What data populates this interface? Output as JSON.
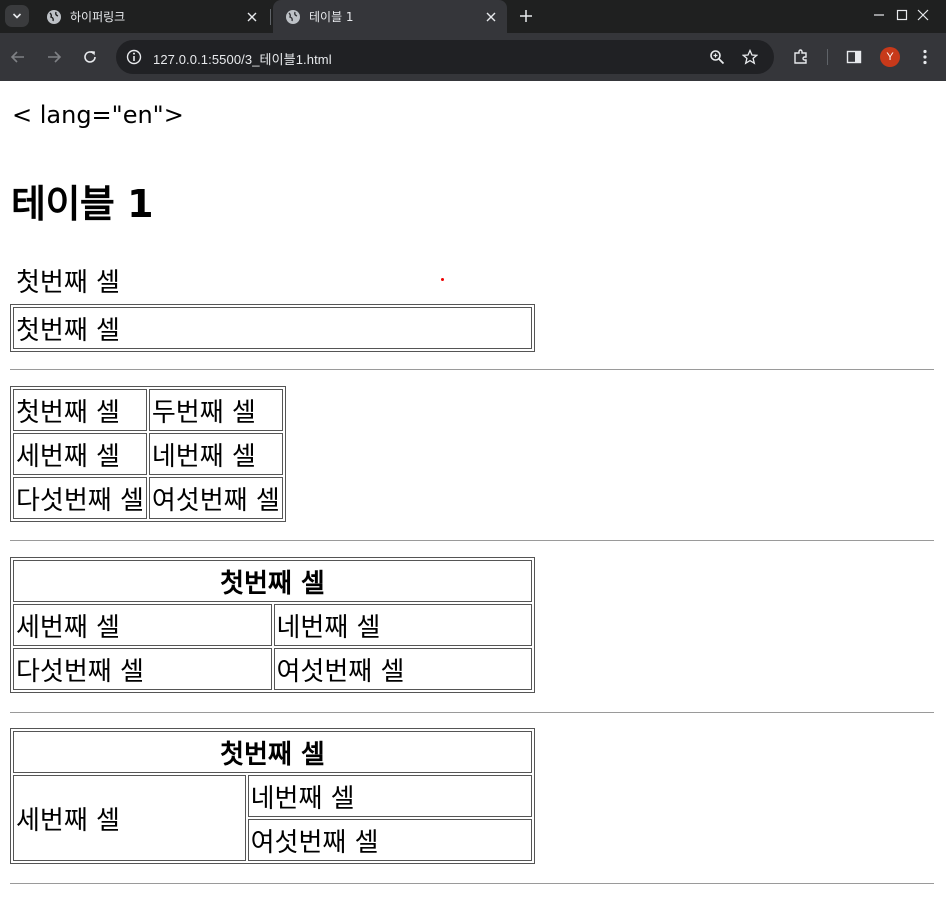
{
  "browser": {
    "tabs": [
      {
        "title": "하이퍼링크",
        "active": false
      },
      {
        "title": "테이블 1",
        "active": true
      }
    ],
    "url": "127.0.0.1:5500/3_테이블1.html",
    "profile_initial": "Y",
    "colors": {
      "tabbar": "#1f2020",
      "toolbar": "#35363a",
      "omnibox": "#202124",
      "avatar": "#c7391a"
    }
  },
  "page": {
    "lang_text": "< lang=\"en\">",
    "heading": "테이블 1",
    "caption_text": "첫번째 셀",
    "table1": {
      "cell": "첫번째 셀"
    },
    "table2": {
      "rows": [
        [
          "첫번째 셀",
          "두번째 셀"
        ],
        [
          "세번째 셀",
          "네번째 셀"
        ],
        [
          "다섯번째 셀",
          "여섯번째 셀"
        ]
      ]
    },
    "table3": {
      "header": "첫번째 셀",
      "rows": [
        [
          "세번째 셀",
          "네번째 셀"
        ],
        [
          "다섯번째 셀",
          "여섯번째 셀"
        ]
      ]
    },
    "table4": {
      "header": "첫번째 셀",
      "rowspan_cell": "세번째 셀",
      "right_cells": [
        "네번째 셀",
        "여섯번째 셀"
      ]
    }
  }
}
